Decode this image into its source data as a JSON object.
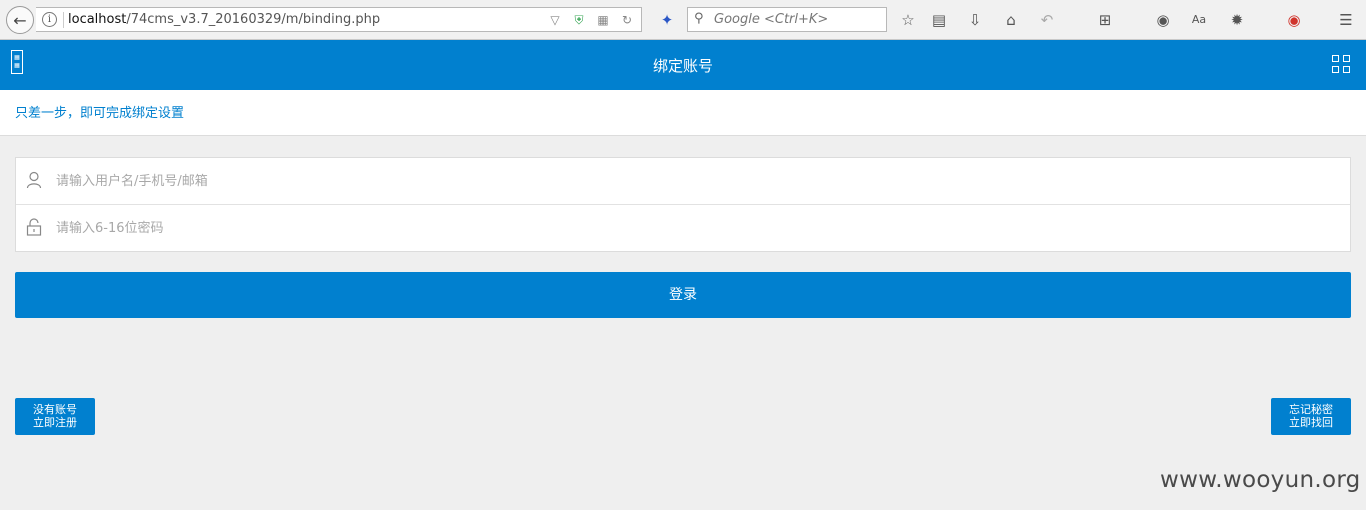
{
  "browser": {
    "url_host": "localhost",
    "url_path": "/74cms_v3.7_20160329/m/binding.php",
    "search_placeholder": "Google <Ctrl+K>"
  },
  "header": {
    "title": "绑定账号",
    "left_icon": "qr-code-icon",
    "right_icon": "grid-menu-icon"
  },
  "notice": {
    "text": "只差一步，即可完成绑定设置"
  },
  "form": {
    "username_placeholder": "请输入用户名/手机号/邮箱",
    "password_placeholder": "请输入6-16位密码",
    "username_icon": "user-icon",
    "password_icon": "lock-icon"
  },
  "login_button": "登录",
  "register_button": {
    "line1": "没有账号",
    "line2": "立即注册"
  },
  "forgot_button": {
    "line1": "忘记秘密",
    "line2": "立即找回"
  },
  "watermark": "www.wooyun.org",
  "colors": {
    "primary": "#0180cf",
    "page_bg": "#efefef"
  }
}
